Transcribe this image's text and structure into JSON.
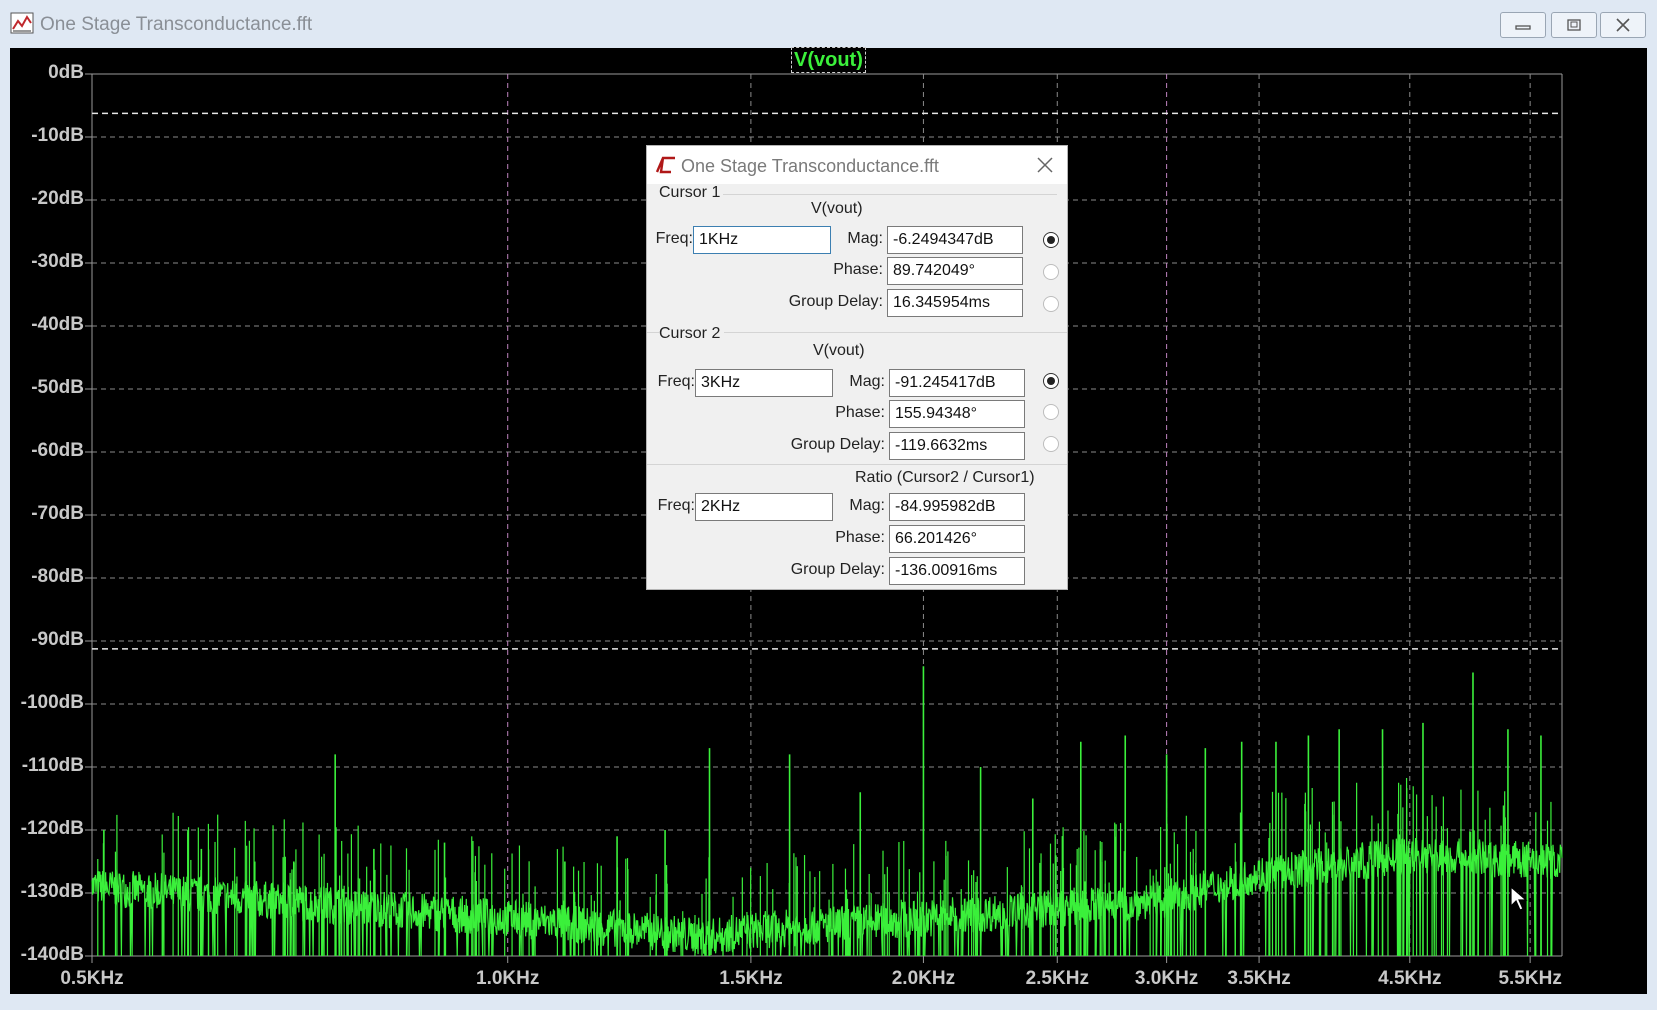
{
  "window": {
    "title": "One Stage Transconductance.fft",
    "icon": "waveform-chart-icon",
    "controls": [
      "minimize-icon",
      "restore-icon",
      "close-icon"
    ]
  },
  "plot": {
    "trace_label": "V(vout)",
    "background": "#000000",
    "trace_color": "#3bf03b",
    "grid_color": "#9a9a9a"
  },
  "chart_data": {
    "type": "line",
    "title": "V(vout)",
    "x_scale": "log",
    "x_ticks": [
      "0.5KHz",
      "1.0KHz",
      "1.5KHz",
      "2.0KHz",
      "2.5KHz",
      "3.0KHz",
      "3.5KHz",
      "4.5KHz",
      "5.5KHz"
    ],
    "x_tick_values": [
      500,
      1000,
      1500,
      2000,
      2500,
      3000,
      3500,
      4500,
      5500
    ],
    "xlim": [
      500,
      5800
    ],
    "y_ticks": [
      "0dB",
      "-10dB",
      "-20dB",
      "-30dB",
      "-40dB",
      "-50dB",
      "-60dB",
      "-70dB",
      "-80dB",
      "-90dB",
      "-100dB",
      "-110dB",
      "-120dB",
      "-130dB",
      "-140dB"
    ],
    "ylim": [
      -140,
      0
    ],
    "grid": true,
    "cursors": [
      {
        "name": "Cursor 1",
        "freq": 1000,
        "mag_db": -6.2494347
      },
      {
        "name": "Cursor 2",
        "freq": 3000,
        "mag_db": -91.245417
      }
    ],
    "series": [
      {
        "name": "V(vout)",
        "noise_floor": [
          [
            500,
            -129
          ],
          [
            1000,
            -134
          ],
          [
            1400,
            -137
          ],
          [
            1500,
            -136
          ],
          [
            2000,
            -134
          ],
          [
            3000,
            -131
          ],
          [
            3500,
            -127
          ],
          [
            4500,
            -124
          ],
          [
            5800,
            -125
          ]
        ],
        "spikes": [
          [
            510,
            -120
          ],
          [
            600,
            -123
          ],
          [
            700,
            -125
          ],
          [
            750,
            -108
          ],
          [
            800,
            -123
          ],
          [
            900,
            -122
          ],
          [
            1100,
            -125
          ],
          [
            1200,
            -121
          ],
          [
            1300,
            -120
          ],
          [
            1400,
            -107
          ],
          [
            1600,
            -108
          ],
          [
            1800,
            -114
          ],
          [
            2000,
            -94
          ],
          [
            2200,
            -110
          ],
          [
            2400,
            -115
          ],
          [
            2600,
            -106
          ],
          [
            2800,
            -105
          ],
          [
            3000,
            -108
          ],
          [
            3200,
            -107
          ],
          [
            3400,
            -106
          ],
          [
            3600,
            -106
          ],
          [
            3800,
            -105
          ],
          [
            4000,
            -104
          ],
          [
            4300,
            -104
          ],
          [
            4600,
            -103
          ],
          [
            5000,
            -95
          ],
          [
            5300,
            -104
          ],
          [
            5600,
            -105
          ]
        ]
      }
    ]
  },
  "dialog": {
    "title": "One Stage Transconductance.fft",
    "close_icon": "close-icon",
    "cursor1": {
      "group": "Cursor 1",
      "trace": "V(vout)",
      "freq_label": "Freq:",
      "freq": "1KHz",
      "mag_label": "Mag:",
      "mag": "-6.2494347dB",
      "phase_label": "Phase:",
      "phase": "89.742049°",
      "gd_label": "Group Delay:",
      "group_delay": "16.345954ms",
      "selected": "mag"
    },
    "cursor2": {
      "group": "Cursor 2",
      "trace": "V(vout)",
      "freq_label": "Freq:",
      "freq": "3KHz",
      "mag_label": "Mag:",
      "mag": "-91.245417dB",
      "phase_label": "Phase:",
      "phase": "155.94348°",
      "gd_label": "Group Delay:",
      "group_delay": "-119.6632ms",
      "selected": "mag"
    },
    "ratio": {
      "group": "Ratio (Cursor2 / Cursor1)",
      "freq_label": "Freq:",
      "freq": "2KHz",
      "mag_label": "Mag:",
      "mag": "-84.995982dB",
      "phase_label": "Phase:",
      "phase": "66.201426°",
      "gd_label": "Group Delay:",
      "group_delay": "-136.00916ms"
    }
  }
}
